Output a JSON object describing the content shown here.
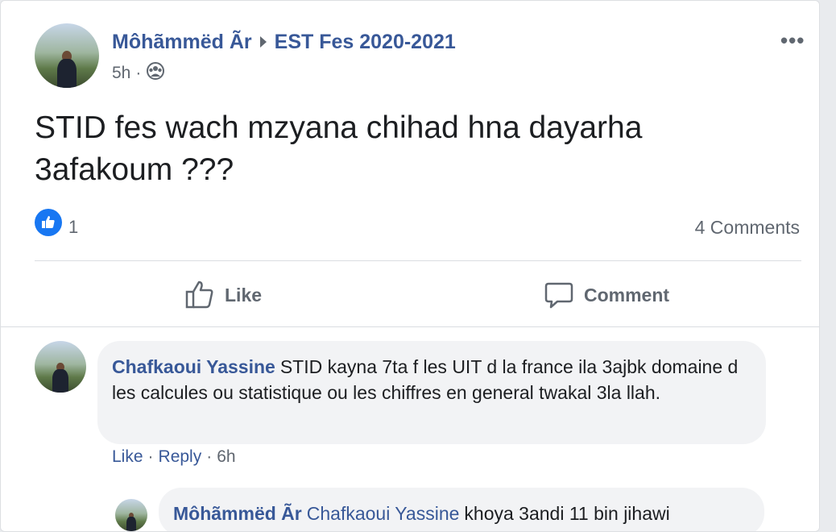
{
  "post": {
    "author": "Môhãmmëd Ãr",
    "group": "EST Fes 2020-2021",
    "time": "5h",
    "separator": "·",
    "more": "•••",
    "text": "STID fes wach mzyana chihad hna dayarha 3afakoum ???",
    "like_count": "1",
    "comments_count": "4 Comments",
    "like_label": "Like",
    "comment_label": "Comment"
  },
  "comment": {
    "author": "Chafkaoui Yassine",
    "text": "STID kayna 7ta f les UIT d la france ila 3ajbk domaine d les calcules ou statistique ou les chiffres en general twakal 3la llah.",
    "like": "Like",
    "dot1": "·",
    "reply": "Reply",
    "dot2": "·",
    "time": "6h"
  },
  "reply": {
    "author": "Môhãmmëd Ãr",
    "tag": "Chafkaoui Yassine",
    "text": "khoya 3andi 11 bin jihawi"
  },
  "colors": {
    "link": "#385898",
    "like_blue": "#1877f2",
    "muted": "#606770",
    "bubble": "#f2f3f5"
  }
}
